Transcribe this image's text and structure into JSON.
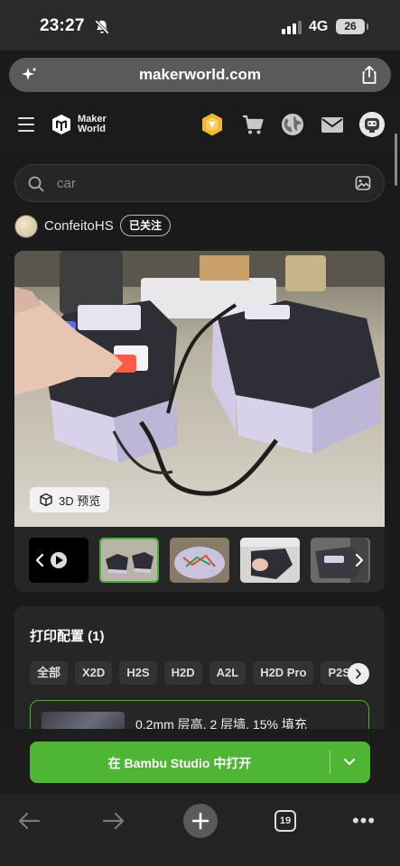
{
  "status_bar": {
    "time": "23:27",
    "network": "4G",
    "battery": "26",
    "icons": [
      "bell-slash-icon",
      "signal-icon",
      "battery-icon"
    ]
  },
  "url_bar": {
    "domain": "makerworld.com",
    "icons": [
      "sparkle-icon",
      "share-icon"
    ]
  },
  "header": {
    "logo_line1": "Maker",
    "logo_line2": "World",
    "icons": [
      "hamburger-icon",
      "coin-icon",
      "cart-icon",
      "globe-icon",
      "mail-icon",
      "avatar-icon"
    ]
  },
  "search": {
    "placeholder": "car",
    "icons": [
      "search-icon",
      "image-search-icon"
    ]
  },
  "author": {
    "name": "ConfeitoHS",
    "follow_label": "已关注"
  },
  "media": {
    "preview_3d_label": "3D 预览",
    "thumbnails": [
      "video",
      "photo-1",
      "photo-2",
      "photo-3",
      "photo-4"
    ],
    "active_thumbnail": 1
  },
  "print_config": {
    "title": "打印配置 (1)",
    "filters": [
      "全部",
      "X2D",
      "H2S",
      "H2D",
      "A2L",
      "H2D Pro",
      "P2S"
    ],
    "profile_description": "0.2mm 层高, 2 层墙, 15% 填充"
  },
  "open_button": {
    "label": "在 Bambu Studio 中打开"
  },
  "browser_toolbar": {
    "tab_count": "19",
    "more_label": "•••"
  },
  "colors": {
    "accent_green": "#4fb534",
    "background": "#1b1b1b",
    "card": "#262626"
  }
}
